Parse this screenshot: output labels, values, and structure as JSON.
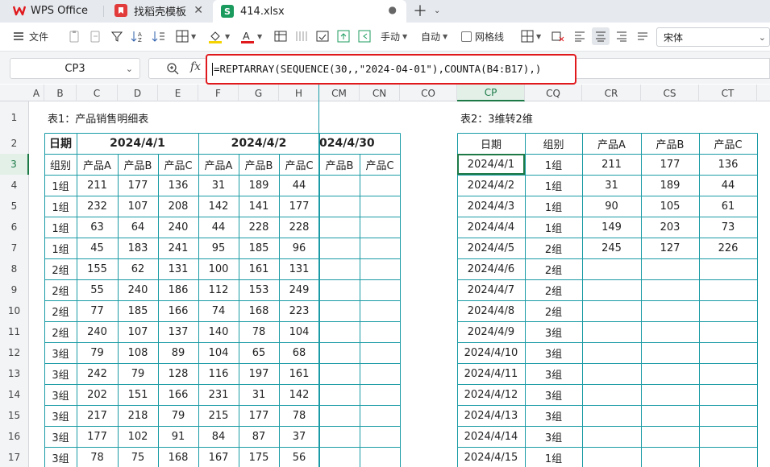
{
  "tabs": {
    "wps_label": "WPS Office",
    "template_label": "找稻壳模板",
    "file_label": "414.xlsx",
    "file_icon_letter": "S"
  },
  "toolbar": {
    "file_label": "文件",
    "manual_label": "手动",
    "auto_label": "自动",
    "gridlines_label": "网格线",
    "font_name": "宋体"
  },
  "formula_bar": {
    "name_box": "CP3",
    "fx_label": "fx",
    "formula": "=REPTARRAY(SEQUENCE(30,,\"2024-04-01\"),COUNTA(B4:B17),)"
  },
  "columns": {
    "labels": [
      "A",
      "B",
      "C",
      "D",
      "E",
      "F",
      "G",
      "H",
      "CM",
      "CN",
      "CO",
      "CP",
      "CQ",
      "CR",
      "CS",
      "CT"
    ],
    "selected": "CP"
  },
  "rows": {
    "labels": [
      "1",
      "2",
      "3",
      "4",
      "5",
      "6",
      "7",
      "8",
      "9",
      "10",
      "11",
      "12",
      "13",
      "14",
      "15",
      "16",
      "17"
    ],
    "selected": "3"
  },
  "table1": {
    "title": "表1：产品销售明细表",
    "date_label": "日期",
    "group_label": "组别",
    "dates": [
      "2024/4/1",
      "2024/4/2",
      "024/4/30"
    ],
    "products": [
      "产品A",
      "产品B",
      "产品C",
      "产品A",
      "产品B",
      "产品C",
      "产品B",
      "产品C"
    ],
    "rows": [
      [
        "1组",
        "211",
        "177",
        "136",
        "31",
        "189",
        "44"
      ],
      [
        "1组",
        "232",
        "107",
        "208",
        "142",
        "141",
        "177"
      ],
      [
        "1组",
        "63",
        "64",
        "240",
        "44",
        "228",
        "228"
      ],
      [
        "1组",
        "45",
        "183",
        "241",
        "95",
        "185",
        "96"
      ],
      [
        "2组",
        "155",
        "62",
        "131",
        "100",
        "161",
        "131"
      ],
      [
        "2组",
        "55",
        "240",
        "186",
        "112",
        "153",
        "249"
      ],
      [
        "2组",
        "77",
        "185",
        "166",
        "74",
        "168",
        "223"
      ],
      [
        "2组",
        "240",
        "107",
        "137",
        "140",
        "78",
        "104"
      ],
      [
        "3组",
        "79",
        "108",
        "89",
        "104",
        "65",
        "68"
      ],
      [
        "3组",
        "242",
        "79",
        "128",
        "116",
        "197",
        "161"
      ],
      [
        "3组",
        "202",
        "151",
        "166",
        "231",
        "31",
        "142"
      ],
      [
        "3组",
        "217",
        "218",
        "79",
        "215",
        "177",
        "78"
      ],
      [
        "3组",
        "177",
        "102",
        "91",
        "84",
        "87",
        "37"
      ],
      [
        "3组",
        "78",
        "75",
        "168",
        "167",
        "175",
        "56"
      ]
    ]
  },
  "table2": {
    "title": "表2：3维转2维",
    "headers": [
      "日期",
      "组别",
      "产品A",
      "产品B",
      "产品C"
    ],
    "rows": [
      [
        "2024/4/1",
        "1组",
        "211",
        "177",
        "136"
      ],
      [
        "2024/4/2",
        "1组",
        "31",
        "189",
        "44"
      ],
      [
        "2024/4/3",
        "1组",
        "90",
        "105",
        "61"
      ],
      [
        "2024/4/4",
        "1组",
        "149",
        "203",
        "73"
      ],
      [
        "2024/4/5",
        "2组",
        "245",
        "127",
        "226"
      ],
      [
        "2024/4/6",
        "2组",
        "",
        "",
        ""
      ],
      [
        "2024/4/7",
        "2组",
        "",
        "",
        ""
      ],
      [
        "2024/4/8",
        "2组",
        "",
        "",
        ""
      ],
      [
        "2024/4/9",
        "3组",
        "",
        "",
        ""
      ],
      [
        "2024/4/10",
        "3组",
        "",
        "",
        ""
      ],
      [
        "2024/4/11",
        "3组",
        "",
        "",
        ""
      ],
      [
        "2024/4/12",
        "3组",
        "",
        "",
        ""
      ],
      [
        "2024/4/13",
        "3组",
        "",
        "",
        ""
      ],
      [
        "2024/4/14",
        "3组",
        "",
        "",
        ""
      ],
      [
        "2024/4/15",
        "1组",
        "",
        "",
        ""
      ]
    ]
  },
  "colors": {
    "accent": "#1d7a47",
    "grid_border": "#1a9ba5",
    "highlight_box": "#e0191d"
  }
}
